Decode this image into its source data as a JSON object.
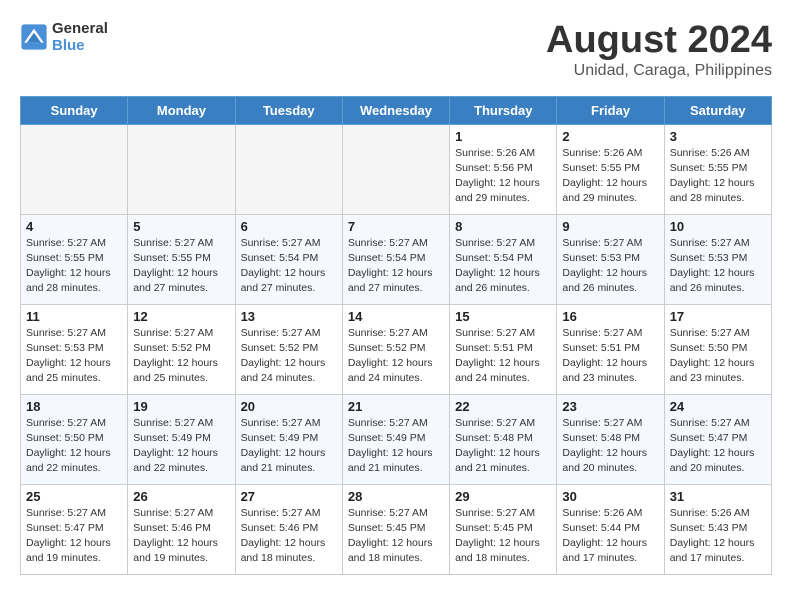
{
  "logo": {
    "line1": "General",
    "line2": "Blue"
  },
  "title": {
    "month_year": "August 2024",
    "location": "Unidad, Caraga, Philippines"
  },
  "weekdays": [
    "Sunday",
    "Monday",
    "Tuesday",
    "Wednesday",
    "Thursday",
    "Friday",
    "Saturday"
  ],
  "weeks": [
    [
      {
        "day": "",
        "info": ""
      },
      {
        "day": "",
        "info": ""
      },
      {
        "day": "",
        "info": ""
      },
      {
        "day": "",
        "info": ""
      },
      {
        "day": "1",
        "info": "Sunrise: 5:26 AM\nSunset: 5:56 PM\nDaylight: 12 hours\nand 29 minutes."
      },
      {
        "day": "2",
        "info": "Sunrise: 5:26 AM\nSunset: 5:55 PM\nDaylight: 12 hours\nand 29 minutes."
      },
      {
        "day": "3",
        "info": "Sunrise: 5:26 AM\nSunset: 5:55 PM\nDaylight: 12 hours\nand 28 minutes."
      }
    ],
    [
      {
        "day": "4",
        "info": "Sunrise: 5:27 AM\nSunset: 5:55 PM\nDaylight: 12 hours\nand 28 minutes."
      },
      {
        "day": "5",
        "info": "Sunrise: 5:27 AM\nSunset: 5:55 PM\nDaylight: 12 hours\nand 27 minutes."
      },
      {
        "day": "6",
        "info": "Sunrise: 5:27 AM\nSunset: 5:54 PM\nDaylight: 12 hours\nand 27 minutes."
      },
      {
        "day": "7",
        "info": "Sunrise: 5:27 AM\nSunset: 5:54 PM\nDaylight: 12 hours\nand 27 minutes."
      },
      {
        "day": "8",
        "info": "Sunrise: 5:27 AM\nSunset: 5:54 PM\nDaylight: 12 hours\nand 26 minutes."
      },
      {
        "day": "9",
        "info": "Sunrise: 5:27 AM\nSunset: 5:53 PM\nDaylight: 12 hours\nand 26 minutes."
      },
      {
        "day": "10",
        "info": "Sunrise: 5:27 AM\nSunset: 5:53 PM\nDaylight: 12 hours\nand 26 minutes."
      }
    ],
    [
      {
        "day": "11",
        "info": "Sunrise: 5:27 AM\nSunset: 5:53 PM\nDaylight: 12 hours\nand 25 minutes."
      },
      {
        "day": "12",
        "info": "Sunrise: 5:27 AM\nSunset: 5:52 PM\nDaylight: 12 hours\nand 25 minutes."
      },
      {
        "day": "13",
        "info": "Sunrise: 5:27 AM\nSunset: 5:52 PM\nDaylight: 12 hours\nand 24 minutes."
      },
      {
        "day": "14",
        "info": "Sunrise: 5:27 AM\nSunset: 5:52 PM\nDaylight: 12 hours\nand 24 minutes."
      },
      {
        "day": "15",
        "info": "Sunrise: 5:27 AM\nSunset: 5:51 PM\nDaylight: 12 hours\nand 24 minutes."
      },
      {
        "day": "16",
        "info": "Sunrise: 5:27 AM\nSunset: 5:51 PM\nDaylight: 12 hours\nand 23 minutes."
      },
      {
        "day": "17",
        "info": "Sunrise: 5:27 AM\nSunset: 5:50 PM\nDaylight: 12 hours\nand 23 minutes."
      }
    ],
    [
      {
        "day": "18",
        "info": "Sunrise: 5:27 AM\nSunset: 5:50 PM\nDaylight: 12 hours\nand 22 minutes."
      },
      {
        "day": "19",
        "info": "Sunrise: 5:27 AM\nSunset: 5:49 PM\nDaylight: 12 hours\nand 22 minutes."
      },
      {
        "day": "20",
        "info": "Sunrise: 5:27 AM\nSunset: 5:49 PM\nDaylight: 12 hours\nand 21 minutes."
      },
      {
        "day": "21",
        "info": "Sunrise: 5:27 AM\nSunset: 5:49 PM\nDaylight: 12 hours\nand 21 minutes."
      },
      {
        "day": "22",
        "info": "Sunrise: 5:27 AM\nSunset: 5:48 PM\nDaylight: 12 hours\nand 21 minutes."
      },
      {
        "day": "23",
        "info": "Sunrise: 5:27 AM\nSunset: 5:48 PM\nDaylight: 12 hours\nand 20 minutes."
      },
      {
        "day": "24",
        "info": "Sunrise: 5:27 AM\nSunset: 5:47 PM\nDaylight: 12 hours\nand 20 minutes."
      }
    ],
    [
      {
        "day": "25",
        "info": "Sunrise: 5:27 AM\nSunset: 5:47 PM\nDaylight: 12 hours\nand 19 minutes."
      },
      {
        "day": "26",
        "info": "Sunrise: 5:27 AM\nSunset: 5:46 PM\nDaylight: 12 hours\nand 19 minutes."
      },
      {
        "day": "27",
        "info": "Sunrise: 5:27 AM\nSunset: 5:46 PM\nDaylight: 12 hours\nand 18 minutes."
      },
      {
        "day": "28",
        "info": "Sunrise: 5:27 AM\nSunset: 5:45 PM\nDaylight: 12 hours\nand 18 minutes."
      },
      {
        "day": "29",
        "info": "Sunrise: 5:27 AM\nSunset: 5:45 PM\nDaylight: 12 hours\nand 18 minutes."
      },
      {
        "day": "30",
        "info": "Sunrise: 5:26 AM\nSunset: 5:44 PM\nDaylight: 12 hours\nand 17 minutes."
      },
      {
        "day": "31",
        "info": "Sunrise: 5:26 AM\nSunset: 5:43 PM\nDaylight: 12 hours\nand 17 minutes."
      }
    ]
  ]
}
